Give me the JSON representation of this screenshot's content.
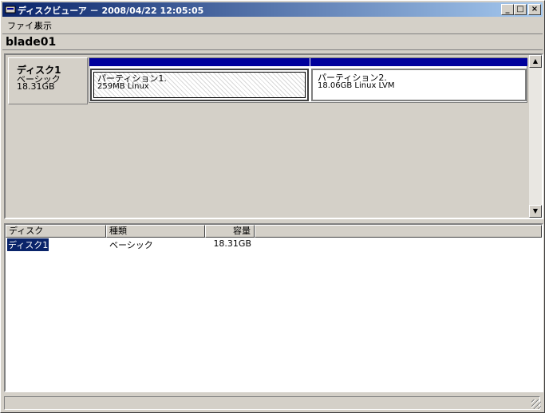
{
  "window": {
    "title": "ディスクビューア － 2008/04/22 12:05:05",
    "minimize": "_",
    "maximize": "□",
    "close": "×"
  },
  "menu": {
    "file": "ファイル",
    "view": "表示"
  },
  "host": {
    "name": "blade01"
  },
  "disk": {
    "name": "ディスク1",
    "type": "ベーシック",
    "size": "18.31GB"
  },
  "partitions": [
    {
      "name": "パーティション1.",
      "desc": "259MB Linux"
    },
    {
      "name": "パーティション2.",
      "desc": "18.06GB Linux LVM"
    }
  ],
  "list": {
    "columns": [
      "ディスク",
      "種類",
      "容量"
    ],
    "rows": [
      {
        "disk": "ディスク1",
        "type": "ベーシック",
        "size": "18.31GB"
      }
    ]
  },
  "colors": {
    "titlebar": "#0a246a",
    "partition_bar": "#00009c",
    "chrome": "#d4d0c8"
  }
}
